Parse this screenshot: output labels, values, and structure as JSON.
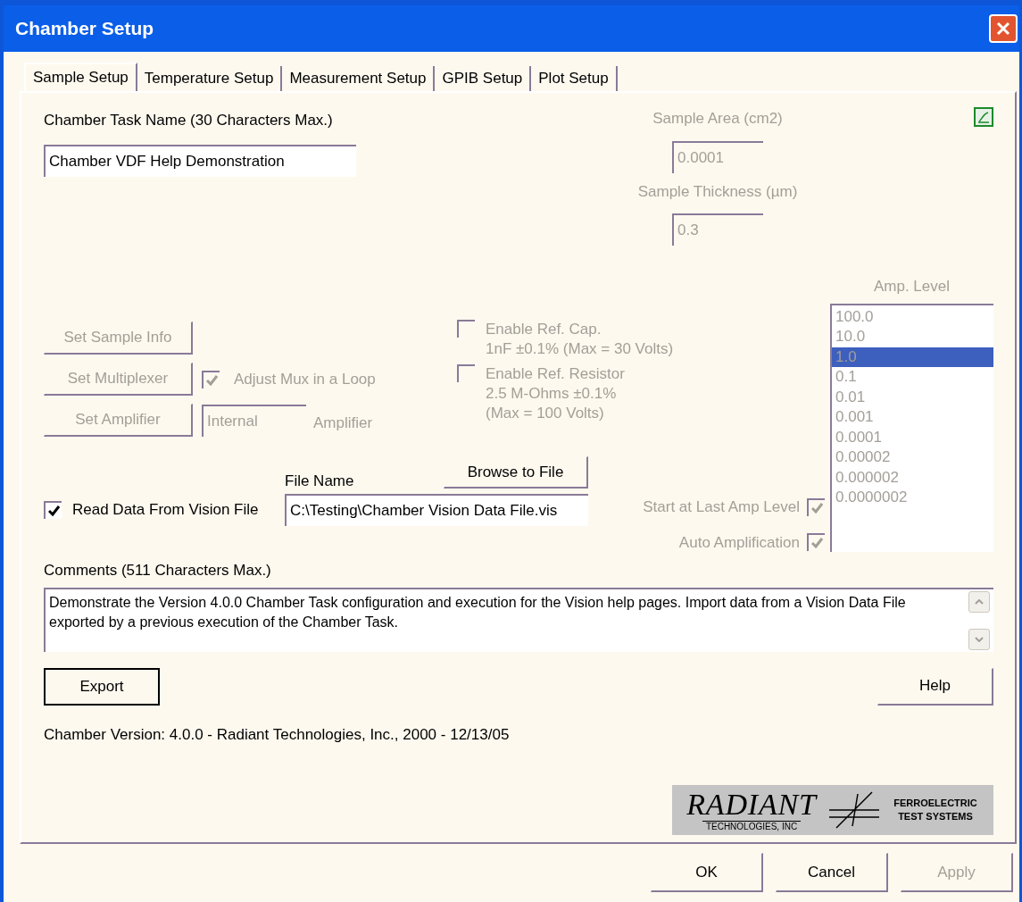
{
  "window": {
    "title": "Chamber Setup"
  },
  "tabs": [
    {
      "label": "Sample Setup",
      "selected": true
    },
    {
      "label": "Temperature Setup",
      "selected": false
    },
    {
      "label": "Measurement Setup",
      "selected": false
    },
    {
      "label": "GPIB Setup",
      "selected": false
    },
    {
      "label": "Plot Setup",
      "selected": false
    }
  ],
  "task_name": {
    "label": "Chamber Task Name (30 Characters Max.)",
    "value": "Chamber VDF Help Demonstration"
  },
  "sample_area": {
    "label": "Sample Area (cm2)",
    "value": "0.0001",
    "disabled": true
  },
  "sample_thickness": {
    "label": "Sample Thickness (µm)",
    "value": "0.3",
    "disabled": true
  },
  "sample_buttons": [
    {
      "label": "Set Sample Info",
      "disabled": true
    },
    {
      "label": "Set Multiplexer",
      "disabled": true
    },
    {
      "label": "Set Amplifier",
      "disabled": true
    }
  ],
  "adjust_mux": {
    "label": "Adjust Mux in a Loop",
    "checked": true,
    "disabled": true
  },
  "amplifier": {
    "value": "Internal",
    "label": "Amplifier",
    "disabled": true
  },
  "ref_options": [
    {
      "label": "Enable Ref. Cap.",
      "detail": [
        "1nF ±0.1% (Max = 30 Volts)"
      ],
      "checked": false,
      "disabled": true
    },
    {
      "label": "Enable Ref. Resistor",
      "detail": [
        "2.5 M-Ohms ±0.1%",
        "(Max = 100 Volts)"
      ],
      "checked": false,
      "disabled": true
    }
  ],
  "read_data": {
    "label": "Read Data From Vision File",
    "checked": true,
    "disabled": false
  },
  "file": {
    "label": "File Name",
    "value": "C:\\Testing\\Chamber Vision Data File.vis",
    "browse": "Browse to File"
  },
  "amp_options": [
    {
      "label": "Start at Last Amp Level",
      "checked": true,
      "disabled": true
    },
    {
      "label": "Auto Amplification",
      "checked": true,
      "disabled": true
    }
  ],
  "amp_level": {
    "label": "Amp. Level",
    "disabled": true,
    "items": [
      {
        "label": "100.0",
        "selected": false
      },
      {
        "label": "10.0",
        "selected": false
      },
      {
        "label": "1.0",
        "selected": true
      },
      {
        "label": "0.1",
        "selected": false
      },
      {
        "label": "0.01",
        "selected": false
      },
      {
        "label": "0.001",
        "selected": false
      },
      {
        "label": "0.0001",
        "selected": false
      },
      {
        "label": "0.00002",
        "selected": false
      },
      {
        "label": "0.000002",
        "selected": false
      },
      {
        "label": "0.0000002",
        "selected": false
      }
    ]
  },
  "comments": {
    "label": "Comments (511 Characters Max.)",
    "value": "Demonstrate the Version 4.0.0 Chamber Task configuration and execution for the Vision help pages.  Import data from a Vision Data File exported by a previous execution of the Chamber Task."
  },
  "export_button": "Export",
  "help_button": "Help",
  "version": "Chamber Version: 4.0.0 - Radiant Technologies, Inc., 2000 - 12/13/05",
  "logo": {
    "name": "RADIANT",
    "subtitle": "TECHNOLOGIES, INC",
    "tagline": [
      "FERROELECTRIC",
      "TEST SYSTEMS"
    ]
  },
  "dialog_buttons": [
    {
      "label": "OK",
      "disabled": false
    },
    {
      "label": "Cancel",
      "disabled": false
    },
    {
      "label": "Apply",
      "disabled": true
    }
  ]
}
